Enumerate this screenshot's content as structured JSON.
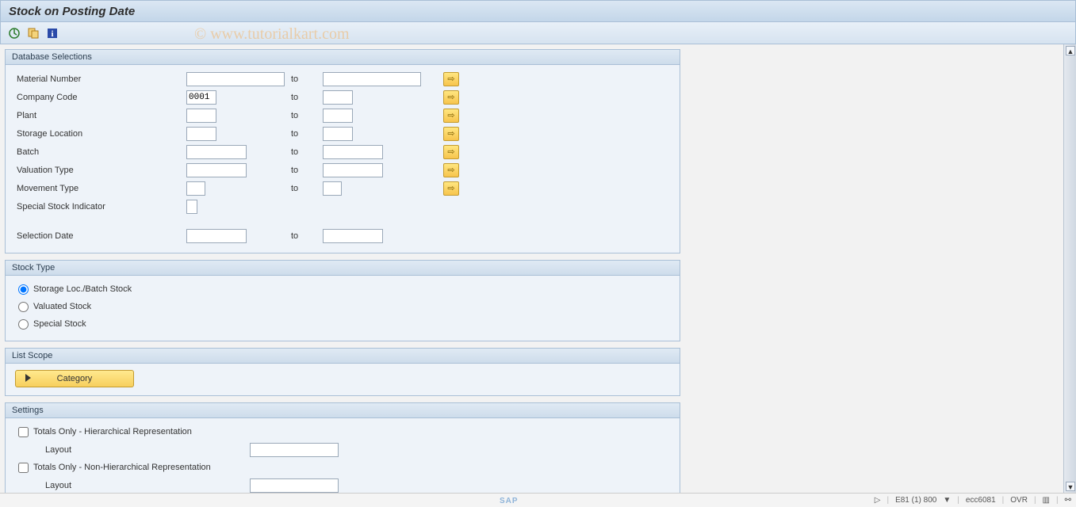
{
  "title": "Stock on Posting Date",
  "watermark": "© www.tutorialkart.com",
  "toolbar": {
    "execute_icon": "execute-icon",
    "variant_icon": "variant-icon",
    "info_icon": "info-icon"
  },
  "groups": {
    "db": {
      "title": "Database Selections",
      "rows": {
        "material": {
          "label": "Material Number",
          "from": "",
          "to_lbl": "to",
          "to": ""
        },
        "company": {
          "label": "Company Code",
          "from": "0001",
          "to_lbl": "to",
          "to": ""
        },
        "plant": {
          "label": "Plant",
          "from": "",
          "to_lbl": "to",
          "to": ""
        },
        "storage": {
          "label": "Storage Location",
          "from": "",
          "to_lbl": "to",
          "to": ""
        },
        "batch": {
          "label": "Batch",
          "from": "",
          "to_lbl": "to",
          "to": ""
        },
        "valtype": {
          "label": "Valuation Type",
          "from": "",
          "to_lbl": "to",
          "to": ""
        },
        "movtype": {
          "label": "Movement Type",
          "from": "",
          "to_lbl": "to",
          "to": ""
        },
        "special": {
          "label": "Special Stock Indicator",
          "from": ""
        },
        "seldate": {
          "label": "Selection Date",
          "from": "",
          "to_lbl": "to",
          "to": ""
        }
      }
    },
    "stocktype": {
      "title": "Stock Type",
      "opts": {
        "o1": "Storage Loc./Batch Stock",
        "o2": "Valuated Stock",
        "o3": "Special Stock"
      }
    },
    "listscope": {
      "title": "List Scope",
      "category_label": "Category"
    },
    "settings": {
      "title": "Settings",
      "chk1": "Totals Only - Hierarchical Representation",
      "layout1_lbl": "Layout",
      "layout1_val": "",
      "chk2": "Totals Only - Non-Hierarchical Representation",
      "layout2_lbl": "Layout",
      "layout2_val": ""
    }
  },
  "status": {
    "sys": "E81 (1) 800",
    "srv": "ecc6081",
    "mode": "OVR"
  }
}
